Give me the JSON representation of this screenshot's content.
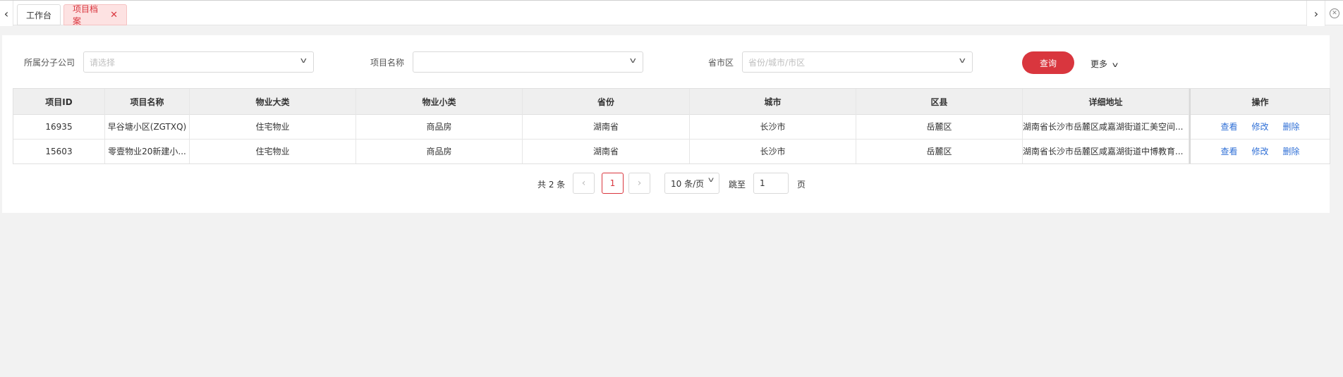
{
  "tabs": {
    "items": [
      {
        "label": "工作台"
      },
      {
        "label": "项目档案",
        "close": "✕"
      }
    ],
    "prev_arrow": "‹",
    "next_arrow": "›",
    "close_all": "✕"
  },
  "filters": {
    "company": {
      "label": "所属分子公司",
      "placeholder": "请选择"
    },
    "project_name": {
      "label": "项目名称",
      "placeholder": ""
    },
    "region": {
      "label": "省市区",
      "placeholder": "省份/城市/市区"
    },
    "query_button": "查询",
    "more": "更多",
    "chevron": "v"
  },
  "table": {
    "headers": [
      "项目ID",
      "项目名称",
      "物业大类",
      "物业小类",
      "省份",
      "城市",
      "区县",
      "详细地址",
      "操作"
    ],
    "rows": [
      {
        "id": "16935",
        "name": "早谷塘小区(ZGTXQ)",
        "category": "住宅物业",
        "subcategory": "商品房",
        "province": "湖南省",
        "city": "长沙市",
        "district": "岳麓区",
        "address": "湖南省长沙市岳麓区咸嘉湖街道汇美空间..."
      },
      {
        "id": "15603",
        "name": "零壹物业20新建小...",
        "category": "住宅物业",
        "subcategory": "商品房",
        "province": "湖南省",
        "city": "长沙市",
        "district": "岳麓区",
        "address": "湖南省长沙市岳麓区咸嘉湖街道中博教育..."
      }
    ],
    "actions": {
      "view": "查看",
      "edit": "修改",
      "delete": "删除"
    }
  },
  "pagination": {
    "total": "共 2 条",
    "prev": "‹",
    "current": "1",
    "next": "›",
    "page_size": "10 条/页",
    "goto_label": "跳至",
    "goto_value": "1",
    "page_suffix": "页"
  },
  "colors": {
    "accent": "#d9363e",
    "link": "#2f6fd6"
  }
}
